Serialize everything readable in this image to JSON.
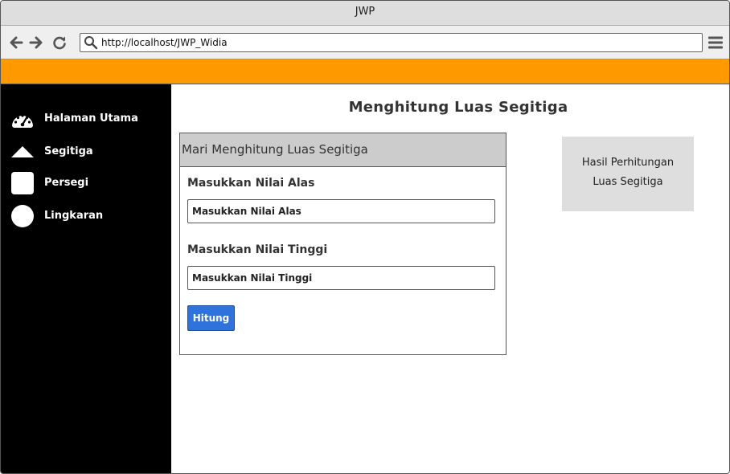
{
  "browser": {
    "window_title": "JWP",
    "url": "http://localhost/JWP_Widia"
  },
  "colors": {
    "accent_bar": "#ff9900",
    "sidebar_bg": "#000000",
    "button_bg": "#2f72dc",
    "panel_header_bg": "#cccccc",
    "result_bg": "#dedede"
  },
  "sidebar": {
    "items": [
      {
        "label": "Halaman Utama",
        "icon": "dashboard-icon"
      },
      {
        "label": "Segitiga",
        "icon": "triangle-icon"
      },
      {
        "label": "Persegi",
        "icon": "square-icon"
      },
      {
        "label": "Lingkaran",
        "icon": "circle-icon"
      }
    ]
  },
  "main": {
    "title": "Menghitung Luas Segitiga",
    "form": {
      "header": "Mari Menghitung Luas Segitiga",
      "alas_label": "Masukkan Nilai Alas",
      "alas_placeholder": "Masukkan Nilai Alas",
      "tinggi_label": "Masukkan Nilai Tinggi",
      "tinggi_placeholder": "Masukkan Nilai Tinggi",
      "submit_label": "Hitung"
    },
    "result": {
      "line1": "Hasil Perhitungan",
      "line2": "Luas Segitiga"
    }
  }
}
